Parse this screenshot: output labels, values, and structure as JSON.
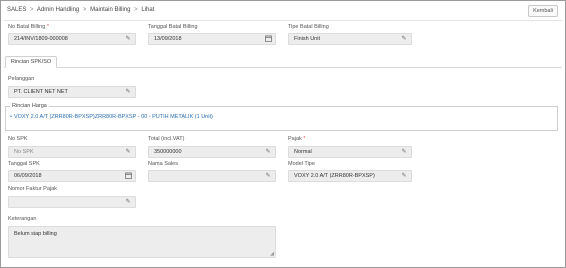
{
  "breadcrumb": {
    "items": [
      "SALES",
      "Admin Handling",
      "Maintain Billing",
      "Lihat"
    ],
    "separator": ">"
  },
  "header": {
    "back_button": "Kembali"
  },
  "top_form": {
    "no_batal_billing": {
      "label": "No Batal Billing",
      "required_mark": "*",
      "value": "214/INV/1809-000008"
    },
    "tanggal_batal_billing": {
      "label": "Tanggal Batal Billing",
      "value": "13/09/2018"
    },
    "tipe_batal_billing": {
      "label": "Tipe Batal Billing",
      "value": "Finish Unit"
    }
  },
  "tabs": [
    {
      "label": "Rincian SPK/SO",
      "active": true
    }
  ],
  "pelanggan": {
    "label": "Pelanggan",
    "value": "PT. CLIENT NET NET"
  },
  "rincian_harga": {
    "legend": "Rincian Harga",
    "items": [
      "VOXY 2.0 A/T (ZRR80R-BPXSP)ZRR80R-BPXSP - 00 - PUTIH METALIK (1 Unit)"
    ]
  },
  "detail": {
    "no_spk": {
      "label": "No SPK",
      "placeholder": "No SPK"
    },
    "total": {
      "label": "Total (incl.VAT)",
      "value": "350000000"
    },
    "pajak": {
      "label": "Pajak",
      "required_mark": "*",
      "value": "Normal"
    },
    "tanggal_spk": {
      "label": "Tanggal SPK",
      "value": "06/09/2018"
    },
    "nama_sales": {
      "label": "Nama Sales",
      "value": ""
    },
    "model_tipe": {
      "label": "Model Tipe",
      "value": "VOXY 2.0 A/T (ZRR80R-BPXSP)"
    },
    "nomor_faktur_pajak": {
      "label": "Nomor Faktur Pajak",
      "value": ""
    }
  },
  "keterangan": {
    "label": "Keterangan",
    "value": "Belum siap billing"
  },
  "icons": {
    "edit": "pencil-icon",
    "calendar": "calendar-icon",
    "resize": "resize-grip-icon"
  },
  "colors": {
    "link": "#2a6fb0",
    "required": "#d9534f",
    "field_bg": "#ededed"
  }
}
